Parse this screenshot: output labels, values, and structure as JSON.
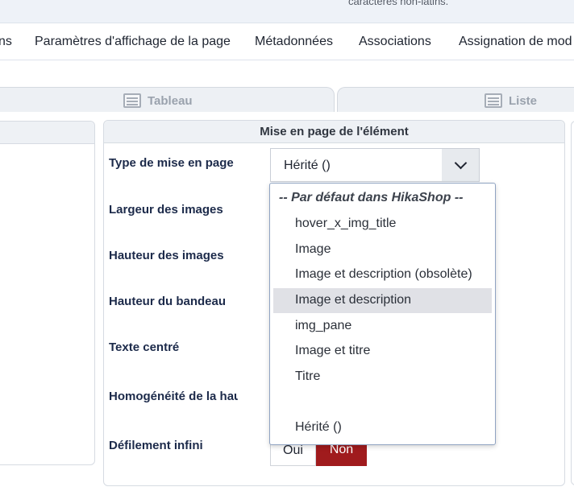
{
  "header": {
    "hint_text": "caractères non-latins."
  },
  "tabs": [
    {
      "label": "ns"
    },
    {
      "label": "Paramètres d'affichage de la page"
    },
    {
      "label": "Métadonnées"
    },
    {
      "label": "Associations"
    },
    {
      "label": "Assignation de mod"
    }
  ],
  "view_switch": {
    "table_label": "Tableau",
    "list_label": "Liste"
  },
  "panel": {
    "title": "Mise en page de l'élément",
    "fields": {
      "layout_type": "Type de mise en page",
      "image_width": "Largeur des images",
      "image_height": "Hauteur des images",
      "banner_height": "Hauteur du bandeau",
      "centered_text": "Texte centré",
      "homogeneity": "Homogénéité de la hauteur",
      "infinite_scroll": "Défilement infini"
    },
    "layout_select": {
      "selected": "Hérité ()",
      "options": [
        {
          "label": "-- Par défaut dans HikaShop --",
          "group": true
        },
        {
          "label": "hover_x_img_title"
        },
        {
          "label": "Image"
        },
        {
          "label": "Image et description (obsolète)"
        },
        {
          "label": "Image et description",
          "hovered": true
        },
        {
          "label": "img_pane"
        },
        {
          "label": "Image et titre"
        },
        {
          "label": "Titre"
        },
        {
          "label": ""
        },
        {
          "label": "Hérité ()"
        }
      ]
    },
    "infinite_scroll_toggle": {
      "yes": "Oui",
      "no": "Non",
      "active": "no"
    }
  },
  "colors": {
    "active_toggle": "#a01b1d",
    "hover_option": "#e0e1e6",
    "label_text": "#1c2a4a"
  }
}
